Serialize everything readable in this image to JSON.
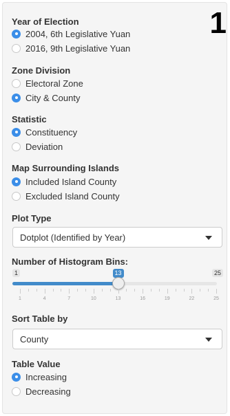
{
  "panel_number": "1",
  "groups": [
    {
      "key": "year",
      "label": "Year of Election",
      "options": [
        {
          "label": "2004, 6th Legislative Yuan",
          "selected": true
        },
        {
          "label": "2016, 9th Legislative Yuan",
          "selected": false
        }
      ]
    },
    {
      "key": "zone",
      "label": "Zone Division",
      "options": [
        {
          "label": "Electoral Zone",
          "selected": false
        },
        {
          "label": "City & County",
          "selected": true
        }
      ]
    },
    {
      "key": "statistic",
      "label": "Statistic",
      "options": [
        {
          "label": "Constituency",
          "selected": true
        },
        {
          "label": "Deviation",
          "selected": false
        }
      ]
    },
    {
      "key": "islands",
      "label": "Map Surrounding Islands",
      "options": [
        {
          "label": "Included Island County",
          "selected": true
        },
        {
          "label": "Excluded Island County",
          "selected": false
        }
      ]
    },
    {
      "key": "table_value",
      "label": "Table Value",
      "options": [
        {
          "label": "Increasing",
          "selected": true
        },
        {
          "label": "Decreasing",
          "selected": false
        }
      ]
    }
  ],
  "plot_type": {
    "label": "Plot Type",
    "value": "Dotplot (Identified by Year)"
  },
  "bins": {
    "label": "Number of Histogram Bins:",
    "min": "1",
    "max": "25",
    "value": "13",
    "min_num": 1,
    "max_num": 25,
    "value_num": 13,
    "tick_labels": [
      "1",
      "4",
      "7",
      "10",
      "13",
      "16",
      "19",
      "22",
      "25"
    ]
  },
  "sort_table": {
    "label": "Sort Table by",
    "value": "County"
  },
  "colors": {
    "accent": "#428bca",
    "radio_on": "#3b8ee8",
    "panel_bg": "#f5f5f5"
  }
}
